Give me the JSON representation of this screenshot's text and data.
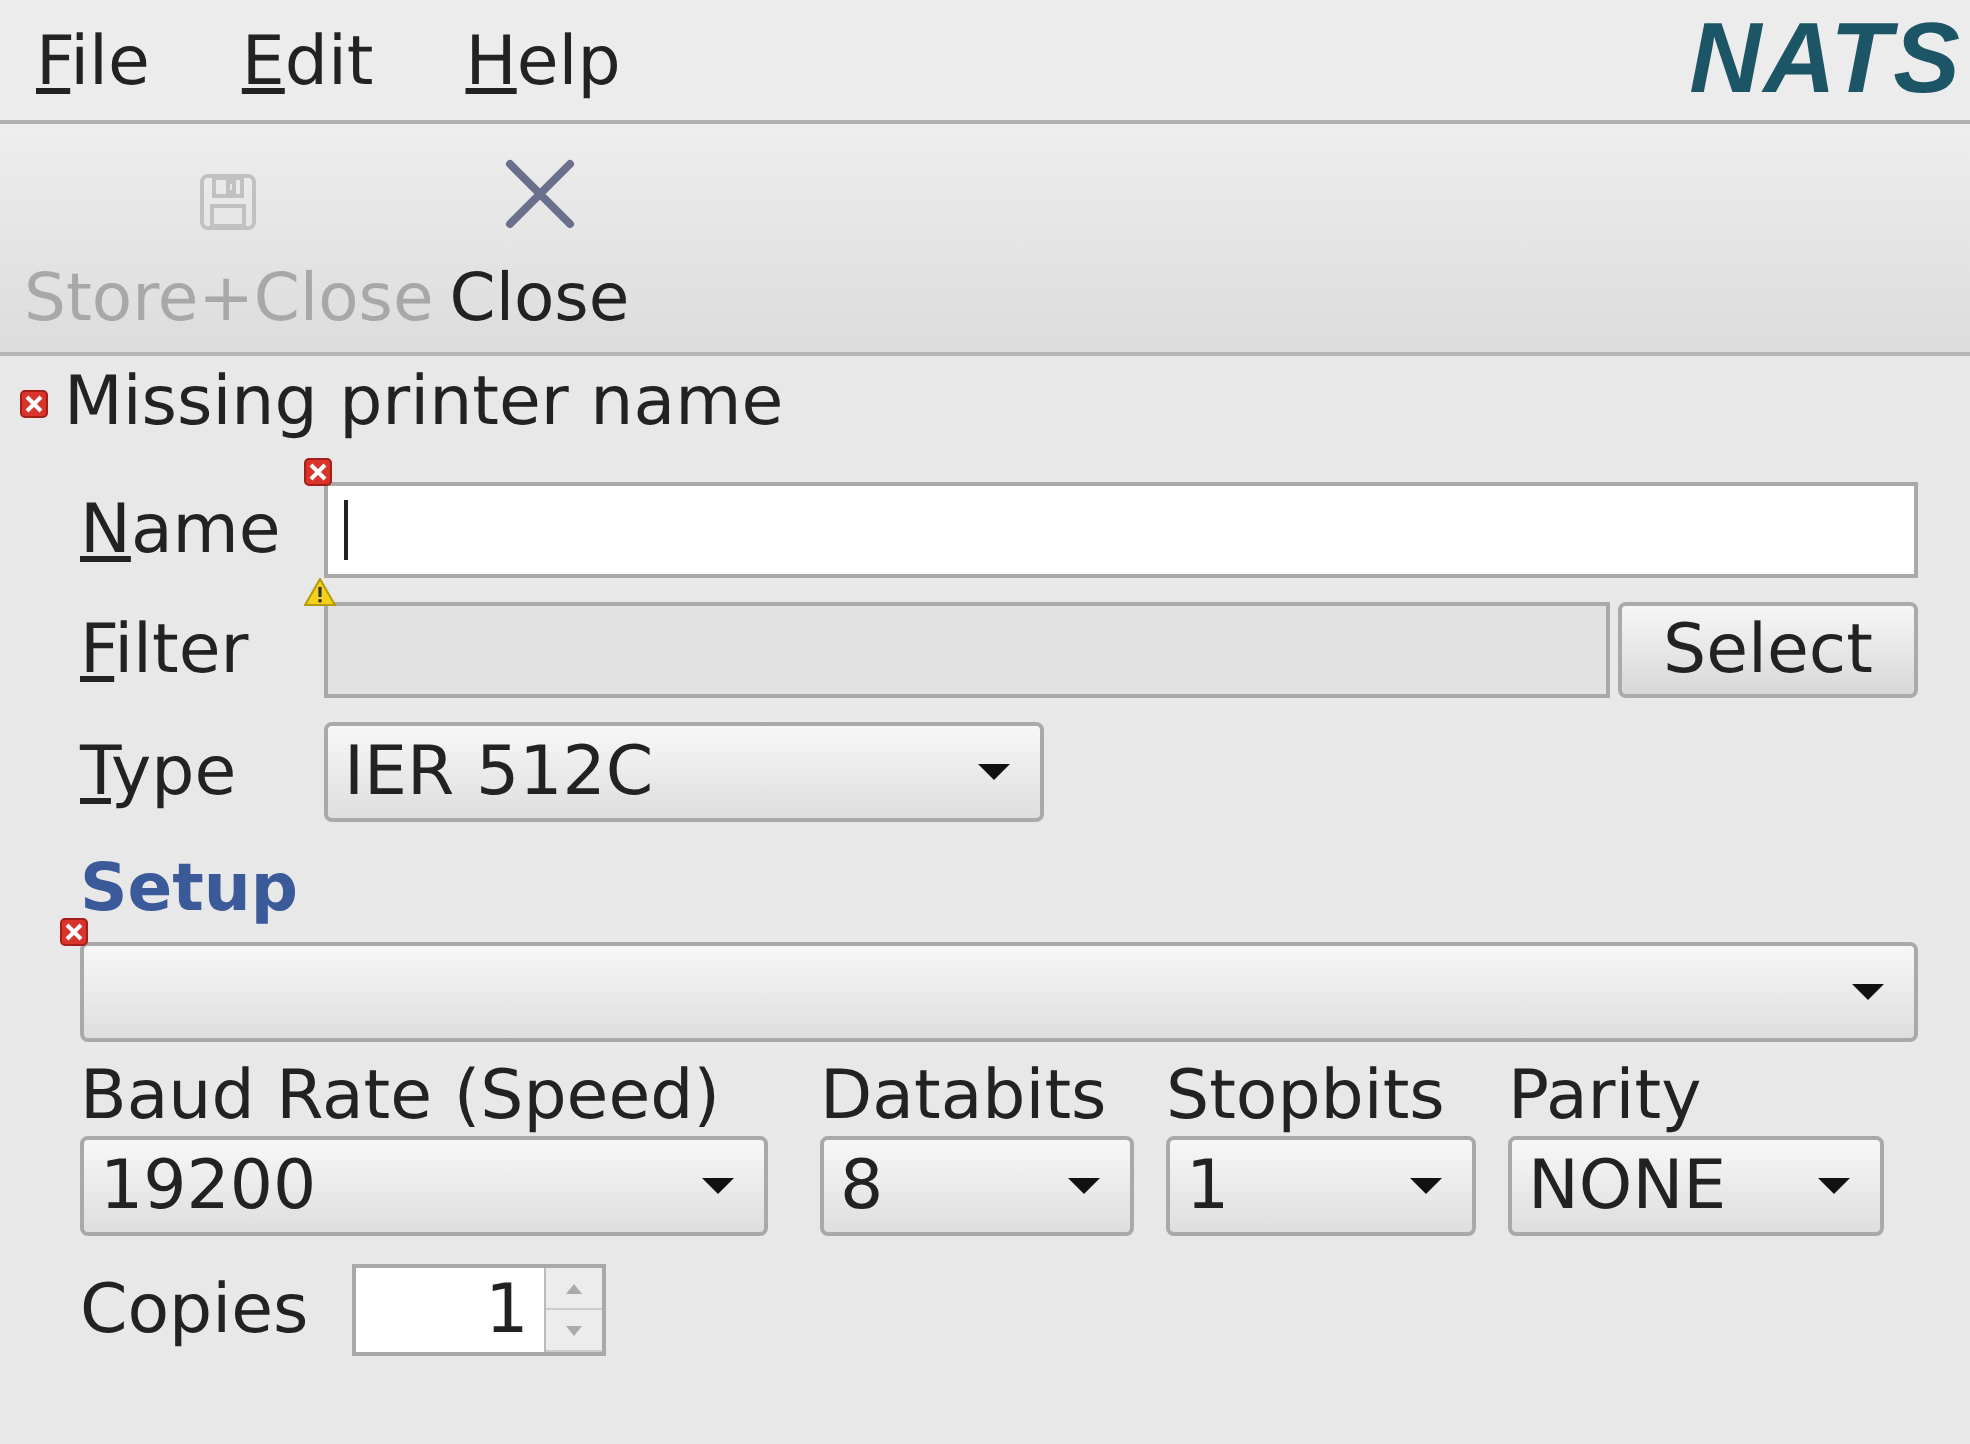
{
  "menu": [
    {
      "label": "File",
      "mnemonic": true
    },
    {
      "label": "Edit",
      "mnemonic": true
    },
    {
      "label": "Help",
      "mnemonic": true
    }
  ],
  "logo": "NATS",
  "toolbar": [
    {
      "label": "Store+Close",
      "kind": "save",
      "disabled": true
    },
    {
      "label": "Close",
      "kind": "close",
      "disabled": false
    }
  ],
  "message": {
    "kind": "error",
    "text": "Missing printer name"
  },
  "form": {
    "name": {
      "label": "Name",
      "mnemonic": true,
      "focused": true,
      "error": true
    },
    "filter": {
      "label": "Filter",
      "mnemonic": true,
      "disabled": true,
      "warning": true,
      "button": "Select"
    },
    "type": {
      "label": "Type",
      "mnemonic": true,
      "value": "IER 512C"
    },
    "setup": {
      "title": "Setup",
      "error": true
    },
    "serial": [
      {
        "label": "Baud Rate (Speed)",
        "value": "19200"
      },
      {
        "label": "Databits",
        "value": "8"
      },
      {
        "label": "Stopbits",
        "value": "1"
      },
      {
        "label": "Parity",
        "value": "NONE"
      }
    ],
    "copies": {
      "label": "Copies",
      "value": "1"
    }
  }
}
